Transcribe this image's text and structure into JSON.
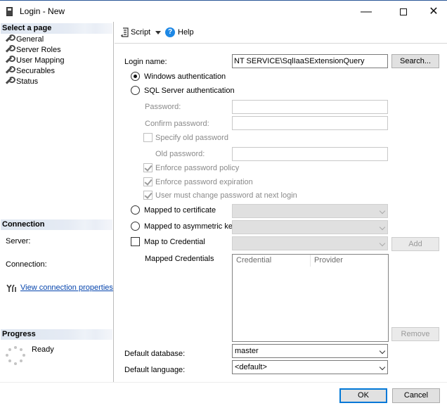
{
  "window": {
    "title": "Login - New",
    "icons": [
      "login-window-icon",
      "minimize-icon",
      "maximize-icon",
      "close-icon"
    ]
  },
  "left": {
    "select_page": "Select a page",
    "pages": [
      {
        "label": "General",
        "icon": "wrench-icon"
      },
      {
        "label": "Server Roles",
        "icon": "wrench-icon"
      },
      {
        "label": "User Mapping",
        "icon": "wrench-icon"
      },
      {
        "label": "Securables",
        "icon": "wrench-icon"
      },
      {
        "label": "Status",
        "icon": "wrench-icon"
      }
    ],
    "connection": {
      "heading": "Connection",
      "server_label": "Server:",
      "connection_label": "Connection:",
      "view_link": "View connection properties"
    },
    "progress": {
      "heading": "Progress",
      "status": "Ready"
    }
  },
  "toolbar": {
    "script": "Script",
    "help": "Help"
  },
  "form": {
    "login_name_label": "Login name:",
    "login_name_value": "NT SERVICE\\SqlIaaSExtensionQuery",
    "search_button": "Search...",
    "windows_auth": "Windows authentication",
    "sql_auth": "SQL Server authentication",
    "password_label": "Password:",
    "confirm_password_label": "Confirm password:",
    "specify_old_password": "Specify old password",
    "old_password_label": "Old password:",
    "enforce_policy": "Enforce password policy",
    "enforce_expiration": "Enforce password expiration",
    "must_change": "User must change password at next login",
    "mapped_certificate": "Mapped to certificate",
    "mapped_asymmetric": "Mapped to asymmetric key",
    "map_credential": "Map to Credential",
    "add_button": "Add",
    "mapped_credentials_label": "Mapped Credentials",
    "cred_columns": [
      "Credential",
      "Provider"
    ],
    "remove_button": "Remove",
    "default_database_label": "Default database:",
    "default_database_value": "master",
    "default_language_label": "Default language:",
    "default_language_value": "<default>"
  },
  "footer": {
    "ok": "OK",
    "cancel": "Cancel"
  },
  "colors": {
    "accent": "#0078d7",
    "link": "#0645ad",
    "title_border": "#2b5797"
  }
}
